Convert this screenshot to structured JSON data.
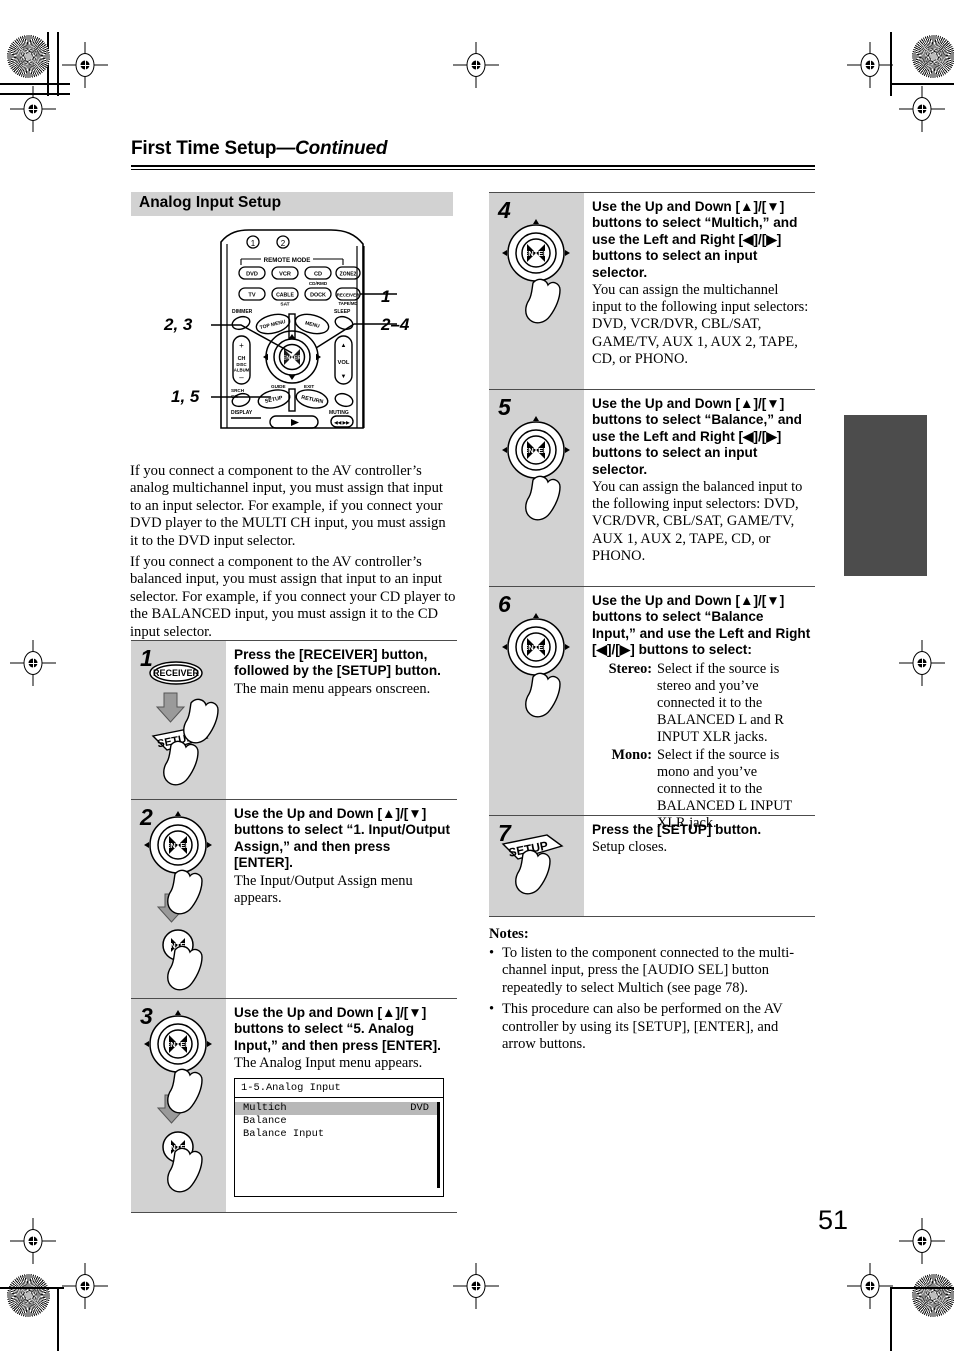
{
  "page": {
    "header_title": "First Time Setup",
    "header_suffix": "—Continued",
    "page_number": "51",
    "section_heading": "Analog Input Setup"
  },
  "figure": {
    "name": "remote-control-diagram",
    "remote_mode_label": "REMOTE MODE",
    "mode_buttons_row1": [
      "DVD",
      "VCR",
      "CD",
      "ZONE2"
    ],
    "mode_buttons_row2": [
      "TV",
      "CABLE",
      "DOCK",
      "RECEIVER"
    ],
    "sub_labels": [
      "CD/RMD",
      "SAT",
      "TAPE/MD"
    ],
    "small_labels": [
      "DIMMER",
      "SLEEP",
      "DISPLAY",
      "MUTING",
      "CH",
      "DISC",
      "ALBUM",
      "VOL",
      "TOP MENU",
      "MENU",
      "SETUP",
      "RETURN",
      "ENTER",
      "GUIDE",
      "EXIT",
      "SRCH",
      "CH"
    ],
    "numbered_keys": [
      "1",
      "2"
    ],
    "callouts": [
      {
        "label": "1",
        "target": "receiver-mode-button"
      },
      {
        "label": "2, 3",
        "target": "dimmer-arrow-keys"
      },
      {
        "label": "2–4",
        "target": "sleep-arrow-keys"
      },
      {
        "label": "1, 5",
        "target": "setup-button"
      }
    ]
  },
  "intro": {
    "paragraph_1": "If you connect a component to the AV controller’s analog multichannel input, you must assign that input to an input selector. For example, if you connect your DVD player to the MULTI CH input, you must assign it to the DVD input selector.",
    "paragraph_2": "If you connect a component to the AV controller’s balanced input, you must assign that input to an input selector. For example, if you connect your CD player to the BALANCED input, you must assign it to the CD input selector."
  },
  "steps": [
    {
      "number": "1",
      "title": "Press the [RECEIVER] button, followed by the [SETUP] button.",
      "desc": "The main menu appears onscreen.",
      "art": "receiver-then-setup-button-press"
    },
    {
      "number": "2",
      "title": "Use the Up and Down [▲]/[▼] buttons to select “1. Input/Output Assign,” and then press [ENTER].",
      "desc": "The Input/Output Assign menu appears.",
      "art": "dpad-then-enter-button-press"
    },
    {
      "number": "3",
      "title": "Use the Up and Down [▲]/[▼] buttons to select “5. Analog Input,” and then press [ENTER].",
      "desc": "The Analog Input menu appears.",
      "art": "dpad-then-enter-button-press",
      "osd": {
        "title": "1-5.Analog Input",
        "rows": [
          {
            "label": "Multich",
            "value": "DVD",
            "selected": true
          },
          {
            "label": "Balance",
            "value": "",
            "selected": false
          },
          {
            "label": "Balance Input",
            "value": "",
            "selected": false
          }
        ]
      }
    },
    {
      "number": "4",
      "title": "Use the Up and Down [▲]/[▼] buttons to select “Multich,” and use the Left and Right [◀]/[▶] buttons to select an input selector.",
      "desc": "You can assign the multichannel input to the following input selectors: DVD, VCR/DVR, CBL/SAT, GAME/TV, AUX 1, AUX 2, TAPE, CD, or PHONO.",
      "art": "dpad-press"
    },
    {
      "number": "5",
      "title": "Use the Up and Down [▲]/[▼] buttons to select “Balance,” and use the Left and Right [◀]/[▶] buttons to select an input selector.",
      "desc": "You can assign the balanced input to the following input selectors: DVD, VCR/DVR, CBL/SAT, GAME/TV, AUX 1, AUX 2, TAPE, CD, or PHONO.",
      "art": "dpad-press"
    },
    {
      "number": "6",
      "title": "Use the Up and Down [▲]/[▼] buttons to select “Balance Input,” and use the Left and Right [◀]/[▶] buttons to select:",
      "art": "dpad-press",
      "definitions": [
        {
          "term": "Stereo:",
          "desc": "Select if the source is stereo and you’ve connected it to the BALANCED L and R INPUT XLR jacks."
        },
        {
          "term": "Mono:",
          "desc": "Select if the source is mono and you’ve connected it to the BALANCED L INPUT XLR jack."
        }
      ]
    },
    {
      "number": "7",
      "title": "Press the [SETUP] button.",
      "desc": "Setup closes.",
      "art": "setup-button-press"
    }
  ],
  "notes": {
    "heading": "Notes:",
    "items": [
      "To listen to the component connected to the multi-channel input, press the [AUDIO SEL] button repeatedly to select Multich (see page 78).",
      "This procedure can also be performed on the AV controller by using its [SETUP], [ENTER], and arrow buttons."
    ],
    "bullet": "•"
  },
  "colors": {
    "step_panel": "#d2d2d2",
    "section_heading_bg": "#d2d2d2",
    "edge_tab": "#4c4c4c",
    "osd_selected": "#b8b8b8"
  }
}
